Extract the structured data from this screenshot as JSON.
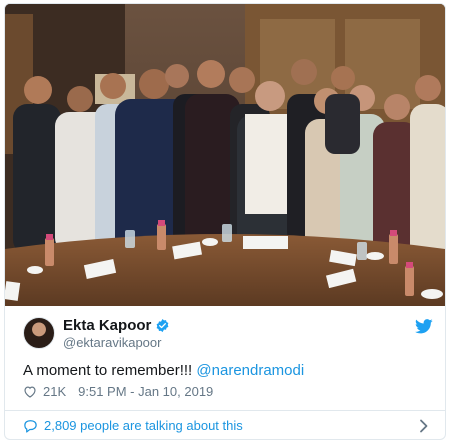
{
  "tweet": {
    "display_name": "Ekta Kapoor",
    "handle": "@ektaravikapoor",
    "text_prefix": "A moment to remember!!! ",
    "mention": "@narendramodi",
    "likes": "21K",
    "timestamp": "9:51 PM - Jan 10, 2019",
    "footer_text": "2,809 people are talking about this"
  },
  "colors": {
    "link": "#1b95e0",
    "muted": "#657786",
    "border": "#e1e8ed"
  },
  "icons": {
    "verified": "verified-badge-icon",
    "bird": "twitter-bird-icon",
    "heart": "heart-outline-icon",
    "bubble": "speech-bubble-icon",
    "chevron": "chevron-right-icon"
  }
}
